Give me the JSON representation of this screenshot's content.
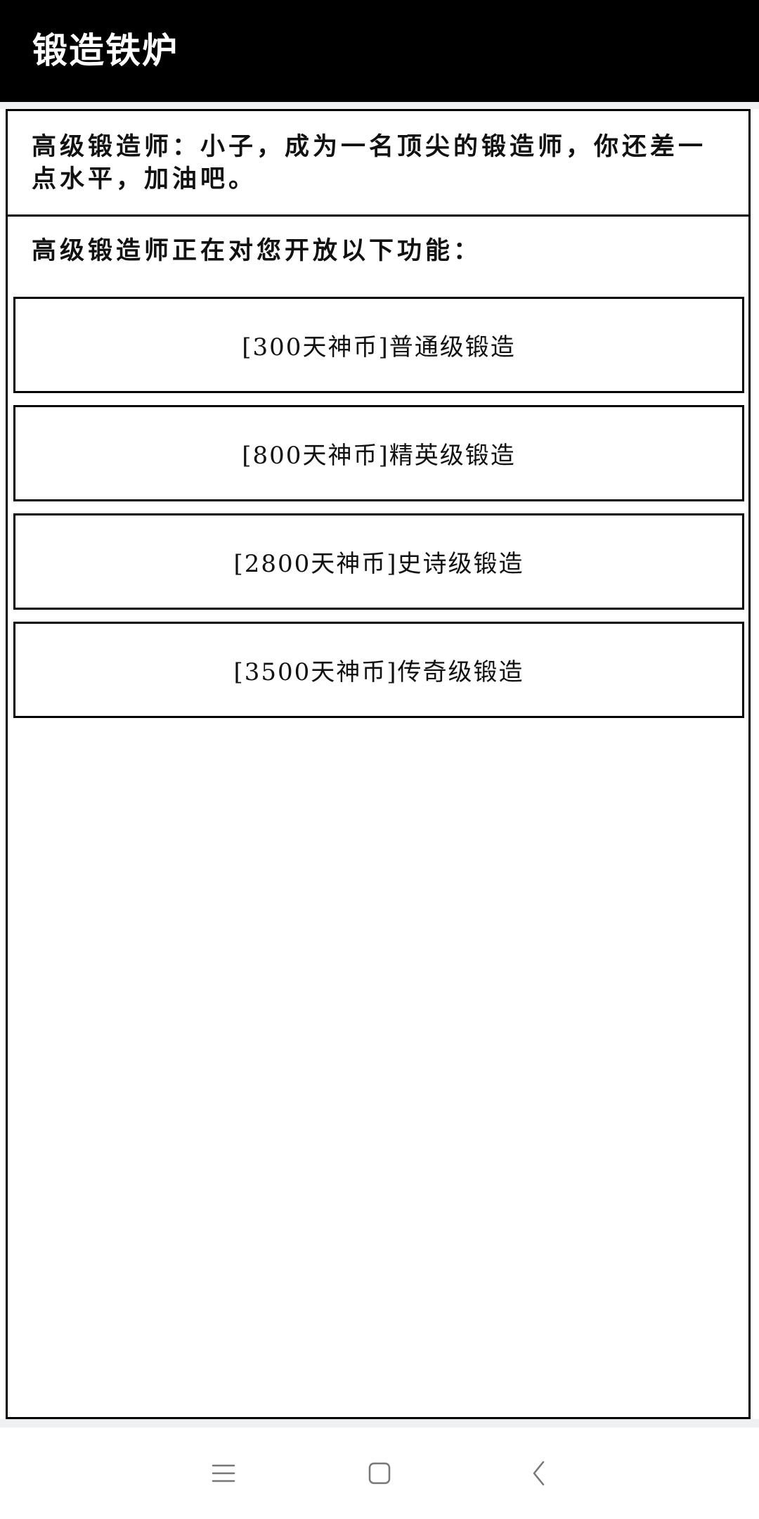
{
  "header": {
    "title": "锻造铁炉"
  },
  "message": {
    "text": "高级锻造师：小子，成为一名顶尖的锻造师，你还差一点水平，加油吧。"
  },
  "intro": {
    "text": "高级锻造师正在对您开放以下功能："
  },
  "options": [
    {
      "label": "[300天神币]普通级锻造"
    },
    {
      "label": "[800天神币]精英级锻造"
    },
    {
      "label": "[2800天神币]史诗级锻造"
    },
    {
      "label": "[3500天神币]传奇级锻造"
    }
  ],
  "navbar": {
    "icons": [
      "menu-icon",
      "home-icon",
      "back-icon"
    ]
  },
  "colors": {
    "header_bg": "#000000",
    "header_text": "#ffffff",
    "border": "#000000",
    "text": "#111111",
    "background": "#ffffff",
    "strip": "#eef0f2"
  }
}
